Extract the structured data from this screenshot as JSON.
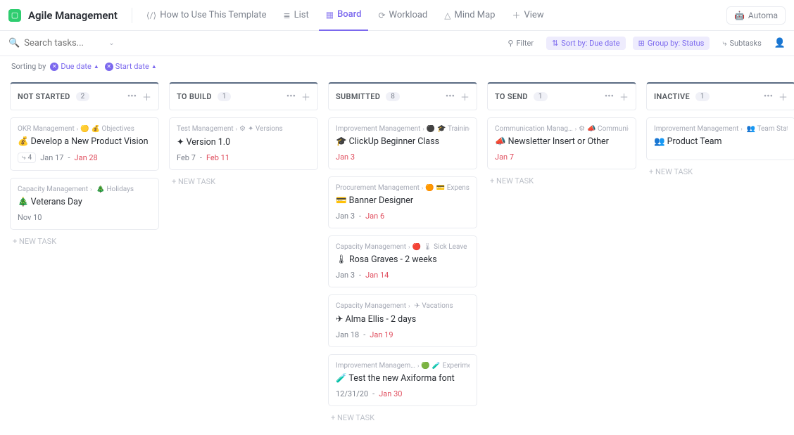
{
  "header": {
    "space": "Agile Management",
    "tabs": [
      {
        "label": "How to Use This Template",
        "icon": "⟨/⟩"
      },
      {
        "label": "List",
        "icon": "≣"
      },
      {
        "label": "Board",
        "icon": "▦",
        "active": true
      },
      {
        "label": "Workload",
        "icon": "⟳"
      },
      {
        "label": "Mind Map",
        "icon": "△"
      }
    ],
    "add_view": "View",
    "automations": "Automa"
  },
  "filterbar": {
    "search_placeholder": "Search tasks...",
    "filter": "Filter",
    "sort": "Sort by: Due date",
    "group": "Group by: Status",
    "subtasks": "Subtasks"
  },
  "sorting": {
    "label": "Sorting by",
    "chips": [
      "Due date",
      "Start date"
    ]
  },
  "columns": [
    {
      "name": "NOT STARTED",
      "count": "2",
      "cards": [
        {
          "bc1": "OKR Management",
          "dot": "🟡",
          "bc2": "💰 Objectives",
          "icon": "💰",
          "title": "Develop a New Product Vision",
          "sub": "4",
          "d1": "Jan 17",
          "d2": "Jan 28"
        },
        {
          "bc1": "Capacity Management",
          "dot": "",
          "bc2": "🎄 Holidays",
          "icon": "🎄",
          "title": "Veterans Day",
          "d1": "Nov 10",
          "d2": ""
        }
      ]
    },
    {
      "name": "TO BUILD",
      "count": "1",
      "cards": [
        {
          "bc1": "Test Management",
          "dot": "⚙",
          "bc2": "✦ Versions",
          "icon": "✦",
          "title": "Version 1.0",
          "d1": "Feb 7",
          "d2": "Feb 11"
        }
      ]
    },
    {
      "name": "SUBMITTED",
      "count": "8",
      "cards": [
        {
          "bc1": "Improvement Management",
          "dot": "⚫",
          "bc2": "🎓 Trainings",
          "icon": "🎓",
          "title": "ClickUp Beginner Class",
          "d1": "Jan 3",
          "d2": "",
          "d1red": true
        },
        {
          "bc1": "Procurement Management",
          "dot": "🟠",
          "bc2": "💳 Expenses",
          "icon": "💳",
          "title": "Banner Designer",
          "d1": "Jan 3",
          "d2": "Jan 6"
        },
        {
          "bc1": "Capacity Management",
          "dot": "🔴",
          "bc2": "🌡 Sick Leave",
          "icon": "🌡",
          "title": "Rosa Graves - 2 weeks",
          "d1": "Jan 3",
          "d2": "Jan 14"
        },
        {
          "bc1": "Capacity Management",
          "dot": "",
          "bc2": "✈ Vacations",
          "icon": "✈",
          "title": "Alma Ellis - 2 days",
          "d1": "Jan 18",
          "d2": "Jan 19"
        },
        {
          "bc1": "Improvement Managem…",
          "dot": "🟢",
          "bc2": "🧪 Experime…",
          "icon": "🧪",
          "title": "Test the new Axiforma font",
          "d1": "12/31/20",
          "d2": "Jan 30"
        }
      ]
    },
    {
      "name": "TO SEND",
      "count": "1",
      "cards": [
        {
          "bc1": "Communication Manag…",
          "dot": "⚙",
          "bc2": "📣 Communica…",
          "icon": "📣",
          "title": "Newsletter Insert or Other",
          "d1": "Jan 7",
          "d2": "",
          "d1red": true
        }
      ]
    },
    {
      "name": "INACTIVE",
      "count": "1",
      "cards": [
        {
          "bc1": "Improvement Management",
          "dot": "",
          "bc2": "👥 Team Status",
          "icon": "👥",
          "title": "Product Team",
          "d1": "",
          "d2": ""
        }
      ]
    }
  ],
  "new_task": "+ NEW TASK"
}
